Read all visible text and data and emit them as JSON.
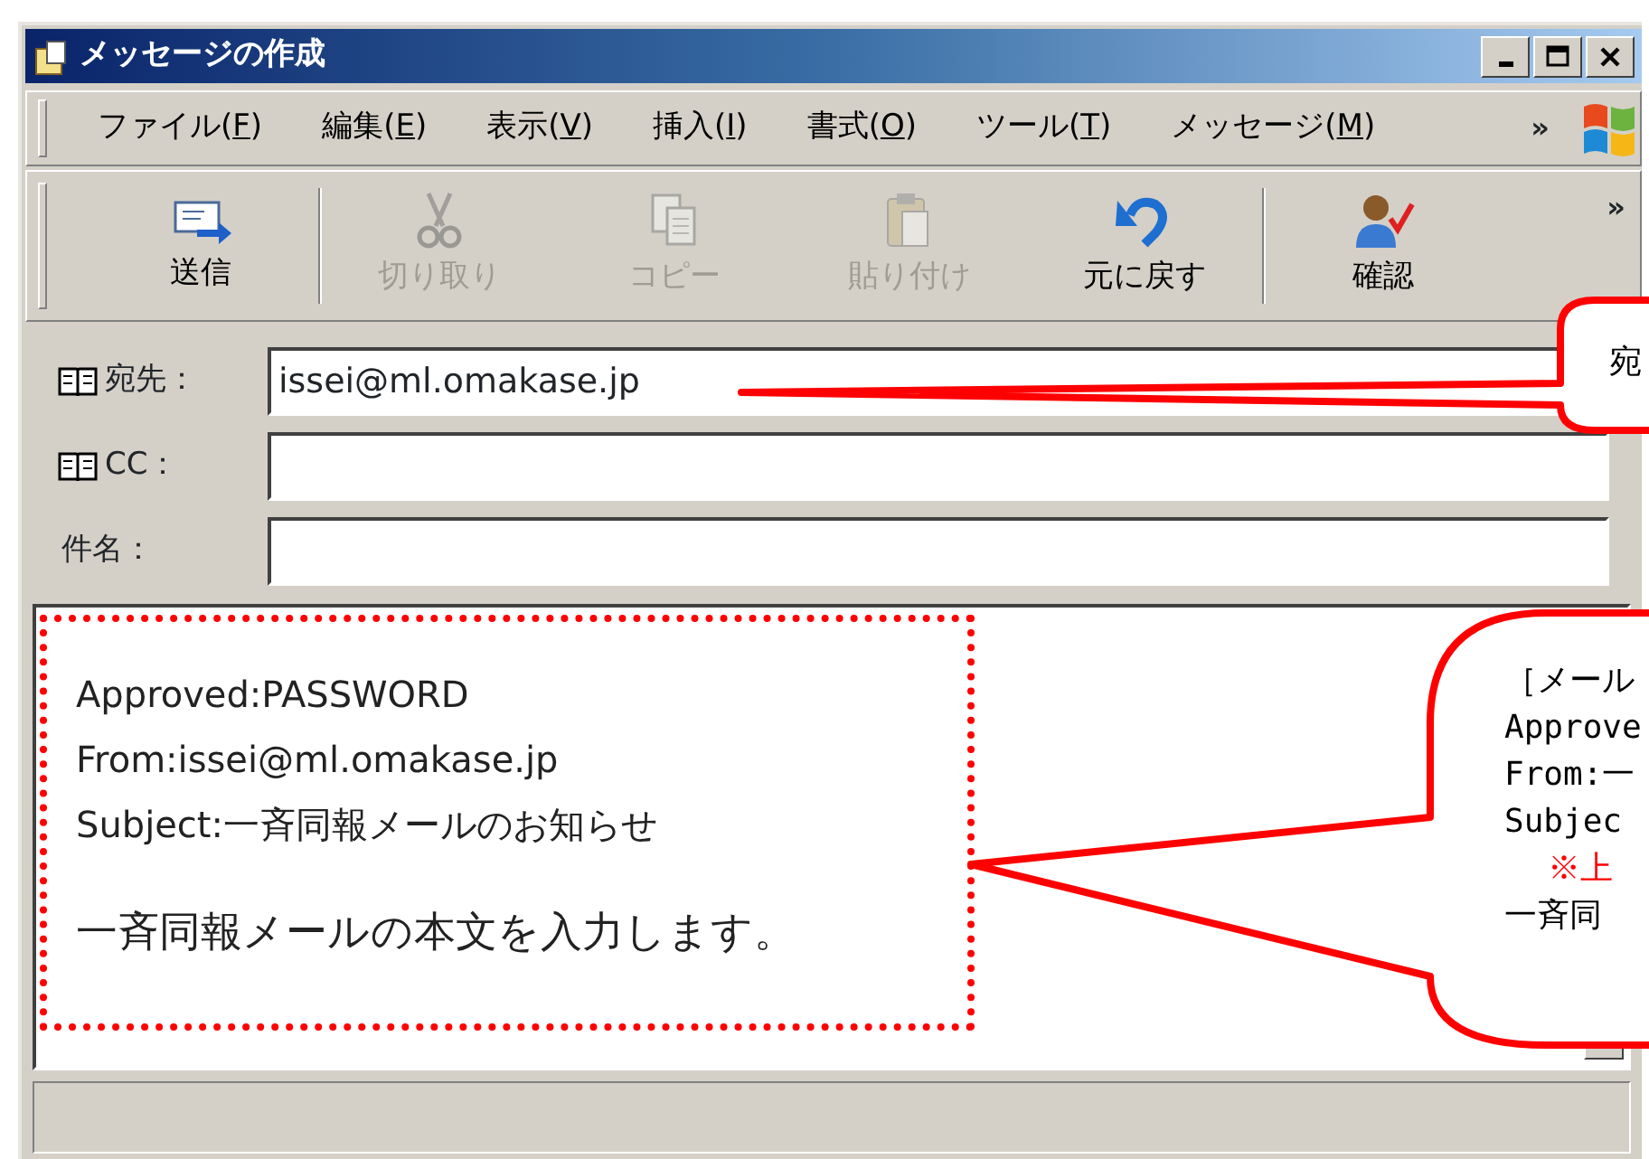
{
  "window": {
    "title": "メッセージの作成"
  },
  "menu": [
    {
      "label": "ファイル(F)"
    },
    {
      "label": "編集(E)"
    },
    {
      "label": "表示(V)"
    },
    {
      "label": "挿入(I)"
    },
    {
      "label": "書式(O)"
    },
    {
      "label": "ツール(T)"
    },
    {
      "label": "メッセージ(M)"
    }
  ],
  "menu_overflow": "»",
  "toolbar": [
    {
      "label": "送信",
      "kind": "send",
      "disabled": false
    },
    {
      "label": "切り取り",
      "kind": "cut",
      "disabled": true
    },
    {
      "label": "コピー",
      "kind": "copy",
      "disabled": true
    },
    {
      "label": "貼り付け",
      "kind": "paste",
      "disabled": true
    },
    {
      "label": "元に戻す",
      "kind": "undo",
      "disabled": false
    },
    {
      "label": "確認",
      "kind": "check",
      "disabled": false
    }
  ],
  "toolbar_overflow": "»",
  "header_fields": [
    {
      "label": "宛先：",
      "kind": "address",
      "value": "issei@ml.omakase.jp"
    },
    {
      "label": "CC：",
      "kind": "address"
    },
    {
      "label": "件名：",
      "kind": "plain"
    }
  ],
  "body": {
    "header_lines": [
      "Approved:PASSWORD",
      "From:issei@ml.omakase.jp",
      "Subject:一斉同報メールのお知らせ"
    ],
    "text": "一斉同報メールの本文を入力します。"
  },
  "callouts": [
    {
      "lines": [
        {
          "text": "宛",
          "kind": "normal"
        }
      ]
    },
    {
      "lines": [
        {
          "text": "［メール",
          "kind": "normal"
        },
        {
          "text": "Approve",
          "kind": "normal"
        },
        {
          "text": "From:一",
          "kind": "normal"
        },
        {
          "text": "Subjec",
          "kind": "normal"
        },
        {
          "text": "※上",
          "kind": "note"
        },
        {
          "text": "一斉同",
          "kind": "normal"
        }
      ]
    }
  ]
}
